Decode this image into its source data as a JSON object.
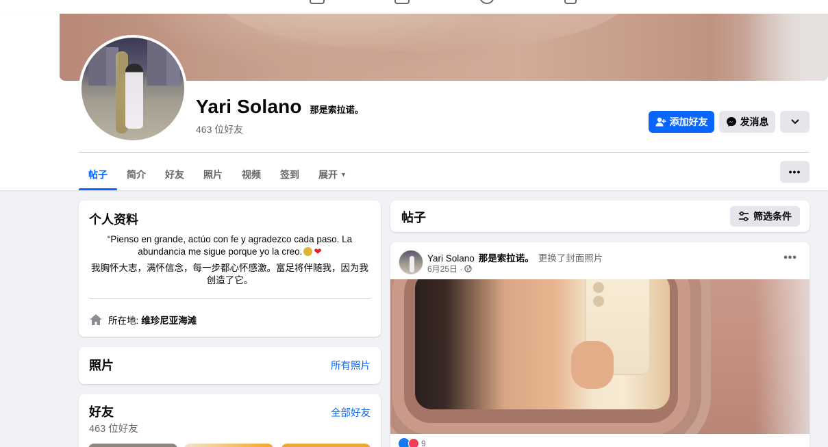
{
  "profile": {
    "name": "Yari Solano",
    "alt_name": "那是索拉诺。",
    "friend_count": "463 位好友"
  },
  "actions": {
    "add_friend": "添加好友",
    "message": "发消息"
  },
  "tabs": [
    {
      "label": "帖子",
      "active": true
    },
    {
      "label": "简介",
      "active": false
    },
    {
      "label": "好友",
      "active": false
    },
    {
      "label": "照片",
      "active": false
    },
    {
      "label": "视频",
      "active": false
    },
    {
      "label": "签到",
      "active": false
    },
    {
      "label": "展开",
      "active": false
    }
  ],
  "intro": {
    "title": "个人资料",
    "bio_es": "“Pienso en grande, actúo con fe y agradezco cada paso. La abundancia me sigue porque yo la creo.",
    "bio_zh": "我胸怀大志，满怀信念，每一步都心怀感激。富足将伴随我，因为我创造了它。",
    "location_label": "所在地:",
    "location_value": "维珍尼亚海滩"
  },
  "photos": {
    "title": "照片",
    "link": "所有照片"
  },
  "friends": {
    "title": "好友",
    "count": "463 位好友",
    "link": "全部好友"
  },
  "posts": {
    "title": "帖子",
    "filter_label": "筛选条件",
    "post": {
      "author": "Yari Solano",
      "alt_name": "那是索拉诺。",
      "action": "更换了封面照片",
      "date": "6月25日 ·",
      "reaction_count": "9"
    }
  },
  "colors": {
    "accent": "#0866ff",
    "page_bg": "#f0f2f5",
    "secondary_text": "#65676b"
  }
}
